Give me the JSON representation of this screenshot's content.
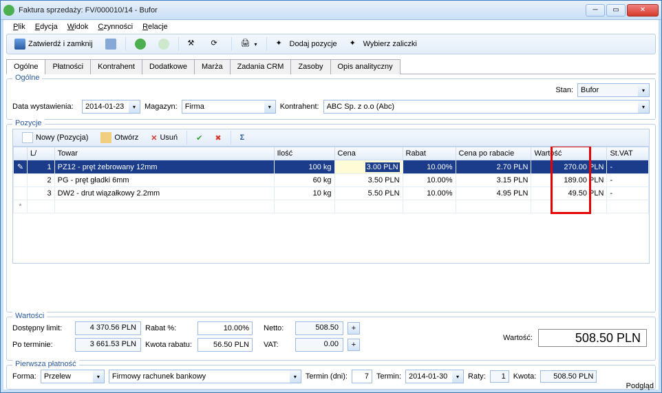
{
  "window": {
    "title": "Faktura sprzedaży: FV/000010/14 - Bufor"
  },
  "menu": {
    "plik": "Plik",
    "edycja": "Edycja",
    "widok": "Widok",
    "czynnosci": "Czynności",
    "relacje": "Relacje"
  },
  "toolbar": {
    "zatwierdz": "Zatwierdź i zamknij",
    "dodaj_pozycje": "Dodaj pozycje",
    "wybierz_zaliczki": "Wybierz zaliczki"
  },
  "tabs": [
    "Ogólne",
    "Płatności",
    "Kontrahent",
    "Dodatkowe",
    "Marża",
    "Zadania CRM",
    "Zasoby",
    "Opis analityczny"
  ],
  "ogolne": {
    "legend": "Ogólne",
    "stan_label": "Stan:",
    "stan_value": "Bufor",
    "data_label": "Data wystawienia:",
    "data_value": "2014-01-23",
    "magazyn_label": "Magazyn:",
    "magazyn_value": "Firma",
    "kontrahent_label": "Kontrahent:",
    "kontrahent_value": "ABC Sp. z o.o (Abc)"
  },
  "pozycje": {
    "legend": "Pozycje",
    "btn_nowy": "Nowy (Pozycja)",
    "btn_otworz": "Otwórz",
    "btn_usun": "Usuń",
    "cols": {
      "lp": "L/",
      "towar": "Towar",
      "ilosc": "Ilość",
      "cena": "Cena",
      "rabat": "Rabat",
      "cenapr": "Cena po rabacie",
      "wartosc": "Wartość",
      "stvat": "St.VAT"
    },
    "rows": [
      {
        "lp": "1",
        "towar": "PZ12 - pręt żebrowany 12mm",
        "ilosc": "100 kg",
        "cena": "3.00 PLN",
        "rabat": "10.00%",
        "cenapr": "2.70 PLN",
        "wartosc": "270.00 PLN",
        "stvat": "-"
      },
      {
        "lp": "2",
        "towar": "PG - pręt gładki 6mm",
        "ilosc": "60 kg",
        "cena": "3.50 PLN",
        "rabat": "10.00%",
        "cenapr": "3.15 PLN",
        "wartosc": "189.00 PLN",
        "stvat": "-"
      },
      {
        "lp": "3",
        "towar": "DW2 - drut wiązałkowy 2.2mm",
        "ilosc": "10 kg",
        "cena": "5.50 PLN",
        "rabat": "10.00%",
        "cenapr": "4.95 PLN",
        "wartosc": "49.50 PLN",
        "stvat": "-"
      }
    ]
  },
  "wartosci": {
    "legend": "Wartości",
    "limit_label": "Dostępny limit:",
    "limit_value": "4 370.56 PLN",
    "rabat_pct_label": "Rabat %:",
    "rabat_pct_value": "10.00%",
    "netto_label": "Netto:",
    "netto_value": "508.50",
    "poterminie_label": "Po terminie:",
    "poterminie_value": "3 661.53 PLN",
    "kwota_rabatu_label": "Kwota rabatu:",
    "kwota_rabatu_value": "56.50 PLN",
    "vat_label": "VAT:",
    "vat_value": "0.00",
    "wartosc_label": "Wartość:",
    "wartosc_value": "508.50 PLN"
  },
  "platnosc": {
    "legend": "Pierwsza płatność",
    "forma_label": "Forma:",
    "forma_value": "Przelew",
    "rachunek_value": "Firmowy rachunek bankowy",
    "termin_dni_label": "Termin (dni):",
    "termin_dni_value": "7",
    "termin_label": "Termin:",
    "termin_value": "2014-01-30",
    "raty_label": "Raty:",
    "raty_value": "1",
    "kwota_label": "Kwota:",
    "kwota_value": "508.50 PLN"
  },
  "status": {
    "podglad": "Podgląd"
  }
}
